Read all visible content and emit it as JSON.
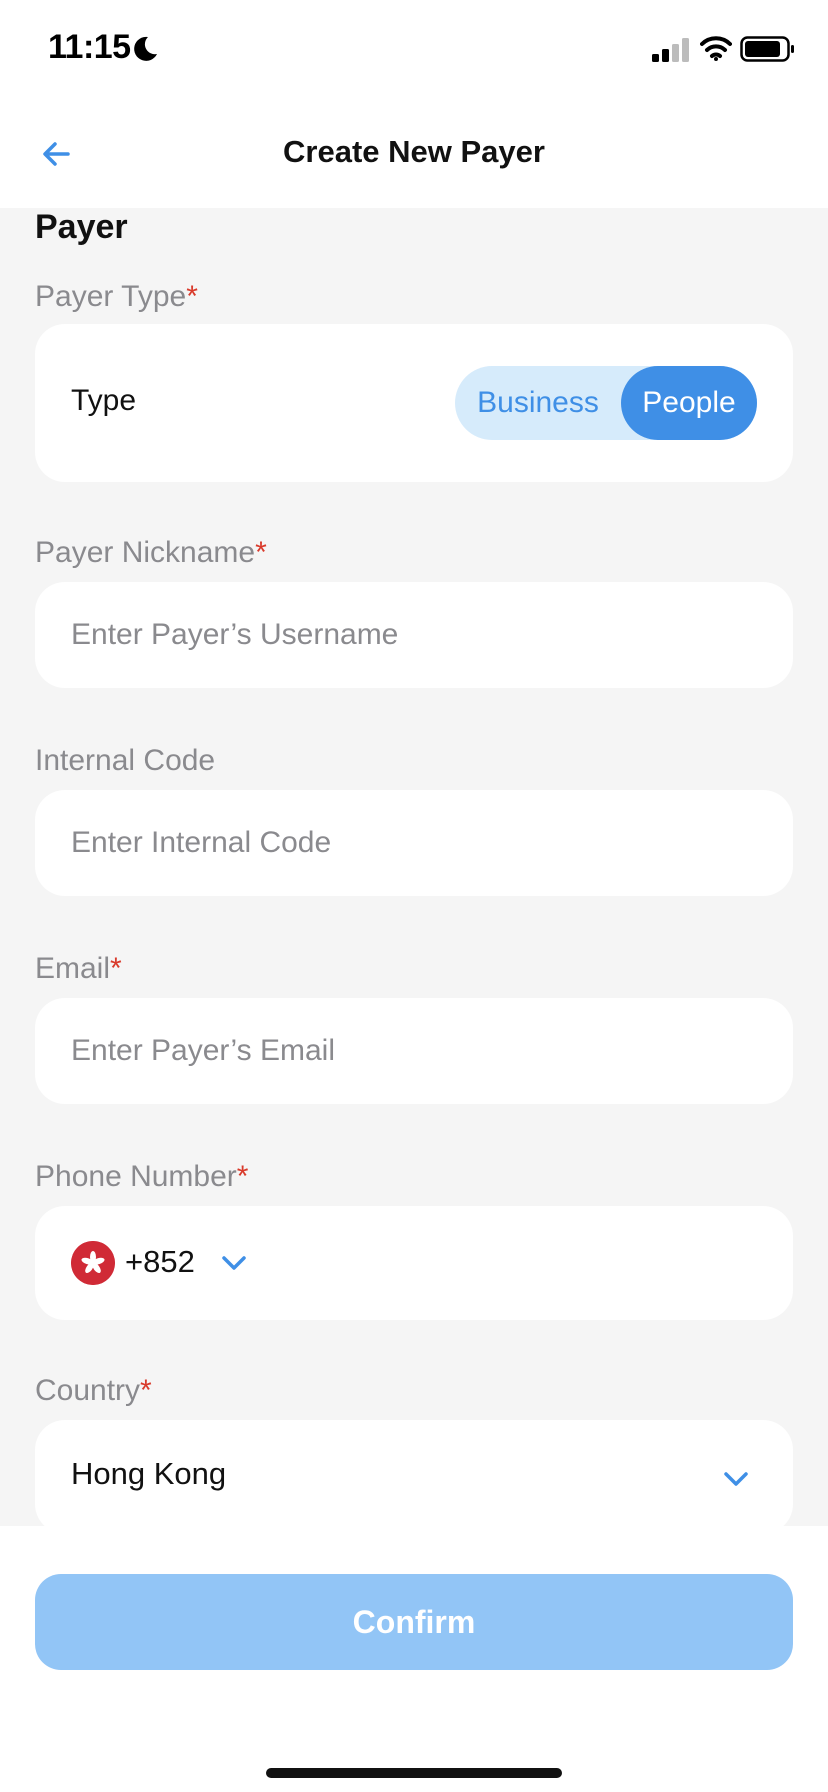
{
  "status_bar": {
    "time": "11:15",
    "icons": [
      "moon-icon",
      "signal-icon",
      "wifi-icon",
      "battery-icon"
    ]
  },
  "nav": {
    "title": "Create New Payer",
    "back_icon": "arrow-left-icon"
  },
  "form": {
    "section_title": "Payer",
    "payer_type": {
      "label": "Payer Type",
      "required_mark": "*",
      "row_label": "Type",
      "options": [
        "Business",
        "People"
      ],
      "selected": "People"
    },
    "nickname": {
      "label": "Payer Nickname",
      "required_mark": "*",
      "placeholder": "Enter Payer’s Username"
    },
    "internal_code": {
      "label": "Internal Code",
      "placeholder": "Enter Internal Code"
    },
    "email": {
      "label": "Email",
      "required_mark": "*",
      "placeholder": "Enter Payer’s Email"
    },
    "phone": {
      "label": "Phone Number",
      "required_mark": "*",
      "dial_code": "+852",
      "flag_icon": "hong-kong-flag-icon"
    },
    "country": {
      "label": "Country",
      "required_mark": "*",
      "value": "Hong Kong"
    }
  },
  "footer": {
    "confirm_label": "Confirm"
  },
  "colors": {
    "accent": "#3f8fe6",
    "accent_light": "#d6ebfb",
    "confirm_disabled": "#92c5f6",
    "required": "#d93a2b",
    "background": "#f5f5f5"
  }
}
